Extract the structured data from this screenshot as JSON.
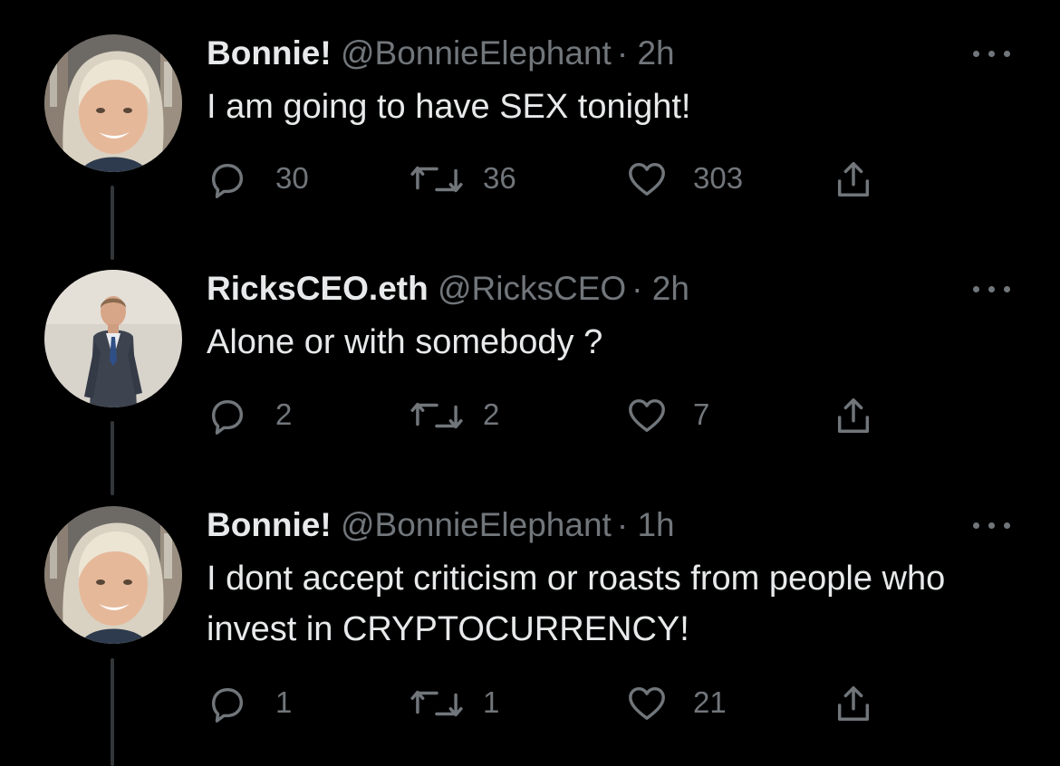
{
  "colors": {
    "background": "#000000",
    "text_primary": "#e7e9ea",
    "text_secondary": "#71767b",
    "thread_line": "#333639"
  },
  "icons": {
    "reply": "speech-bubble",
    "retweet": "two-arrows-loop",
    "like": "heart",
    "share": "box-with-up-arrow",
    "more": "three-dots"
  },
  "tweets": [
    {
      "display_name": "Bonnie!",
      "handle": "@BonnieElephant",
      "separator": "·",
      "time": "2h",
      "text": "I am going to have SEX tonight!",
      "replies": "30",
      "retweets": "36",
      "likes": "303"
    },
    {
      "display_name": "RicksCEO.eth",
      "handle": "@RicksCEO",
      "separator": "·",
      "time": "2h",
      "text": "Alone or with somebody ?",
      "replies": "2",
      "retweets": "2",
      "likes": "7"
    },
    {
      "display_name": "Bonnie!",
      "handle": "@BonnieElephant",
      "separator": "·",
      "time": "1h",
      "text": "I dont accept criticism or roasts from people who invest in CRYPTOCURRENCY!",
      "replies": "1",
      "retweets": "1",
      "likes": "21"
    }
  ]
}
